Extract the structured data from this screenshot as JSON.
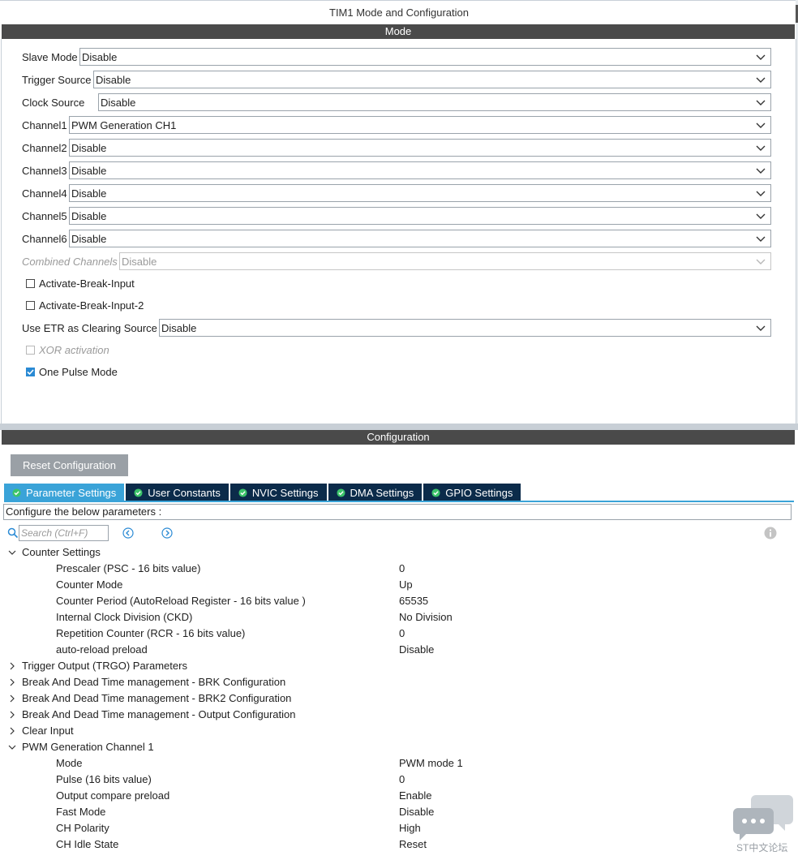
{
  "window": {
    "title": "TIM1 Mode and Configuration"
  },
  "mode_section": {
    "header": "Mode",
    "fields": [
      {
        "label": "Slave Mode",
        "value": "Disable"
      },
      {
        "label": "Trigger Source",
        "value": "Disable"
      },
      {
        "label": "Clock Source",
        "value": "Disable"
      },
      {
        "label": "Channel1",
        "value": "PWM Generation CH1"
      },
      {
        "label": "Channel2",
        "value": "Disable"
      },
      {
        "label": "Channel3",
        "value": "Disable"
      },
      {
        "label": "Channel4",
        "value": "Disable"
      },
      {
        "label": "Channel5",
        "value": "Disable"
      },
      {
        "label": "Channel6",
        "value": "Disable"
      },
      {
        "label": "Combined Channels",
        "value": "Disable",
        "disabled": true
      }
    ],
    "checkboxes": [
      {
        "label": "Activate-Break-Input",
        "checked": false
      },
      {
        "label": "Activate-Break-Input-2",
        "checked": false
      }
    ],
    "etr": {
      "label": "Use ETR as Clearing Source",
      "value": "Disable"
    },
    "checkboxes2": [
      {
        "label": "XOR activation",
        "checked": false,
        "disabled": true
      },
      {
        "label": "One Pulse Mode",
        "checked": true
      }
    ]
  },
  "config_section": {
    "header": "Configuration",
    "reset_button": "Reset Configuration",
    "tabs": [
      {
        "label": "Parameter Settings",
        "active": true
      },
      {
        "label": "User Constants"
      },
      {
        "label": "NVIC Settings"
      },
      {
        "label": "DMA Settings"
      },
      {
        "label": "GPIO Settings"
      }
    ],
    "description": "Configure the below parameters :",
    "search_placeholder": "Search (Ctrl+F)",
    "tree": [
      {
        "type": "group",
        "label": "Counter Settings",
        "expanded": true
      },
      {
        "type": "param",
        "label": "Prescaler (PSC - 16 bits value)",
        "value": "0"
      },
      {
        "type": "param",
        "label": "Counter Mode",
        "value": "Up"
      },
      {
        "type": "param",
        "label": "Counter Period (AutoReload Register - 16 bits value )",
        "value": "65535"
      },
      {
        "type": "param",
        "label": "Internal Clock Division (CKD)",
        "value": "No Division"
      },
      {
        "type": "param",
        "label": "Repetition Counter (RCR - 16 bits value)",
        "value": "0"
      },
      {
        "type": "param",
        "label": "auto-reload preload",
        "value": "Disable"
      },
      {
        "type": "group",
        "label": "Trigger Output (TRGO) Parameters",
        "expanded": false
      },
      {
        "type": "group",
        "label": "Break And Dead Time management - BRK Configuration",
        "expanded": false
      },
      {
        "type": "group",
        "label": "Break And Dead Time management - BRK2 Configuration",
        "expanded": false
      },
      {
        "type": "group",
        "label": "Break And Dead Time management - Output Configuration",
        "expanded": false
      },
      {
        "type": "group",
        "label": "Clear Input",
        "expanded": false
      },
      {
        "type": "group",
        "label": "PWM Generation Channel 1",
        "expanded": true
      },
      {
        "type": "param",
        "label": "Mode",
        "value": "PWM mode 1"
      },
      {
        "type": "param",
        "label": "Pulse (16 bits value)",
        "value": "0"
      },
      {
        "type": "param",
        "label": "Output compare preload",
        "value": "Enable"
      },
      {
        "type": "param",
        "label": "Fast Mode",
        "value": "Disable"
      },
      {
        "type": "param",
        "label": "CH Polarity",
        "value": "High"
      },
      {
        "type": "param",
        "label": "CH Idle State",
        "value": "Reset"
      }
    ]
  },
  "watermark": {
    "text": "ST中文论坛"
  },
  "colors": {
    "tab_active": "#3aa3d8",
    "tab_inactive": "#0b2b4a",
    "header_bar": "#4a4a4a",
    "check_blue": "#2a8ad4"
  }
}
